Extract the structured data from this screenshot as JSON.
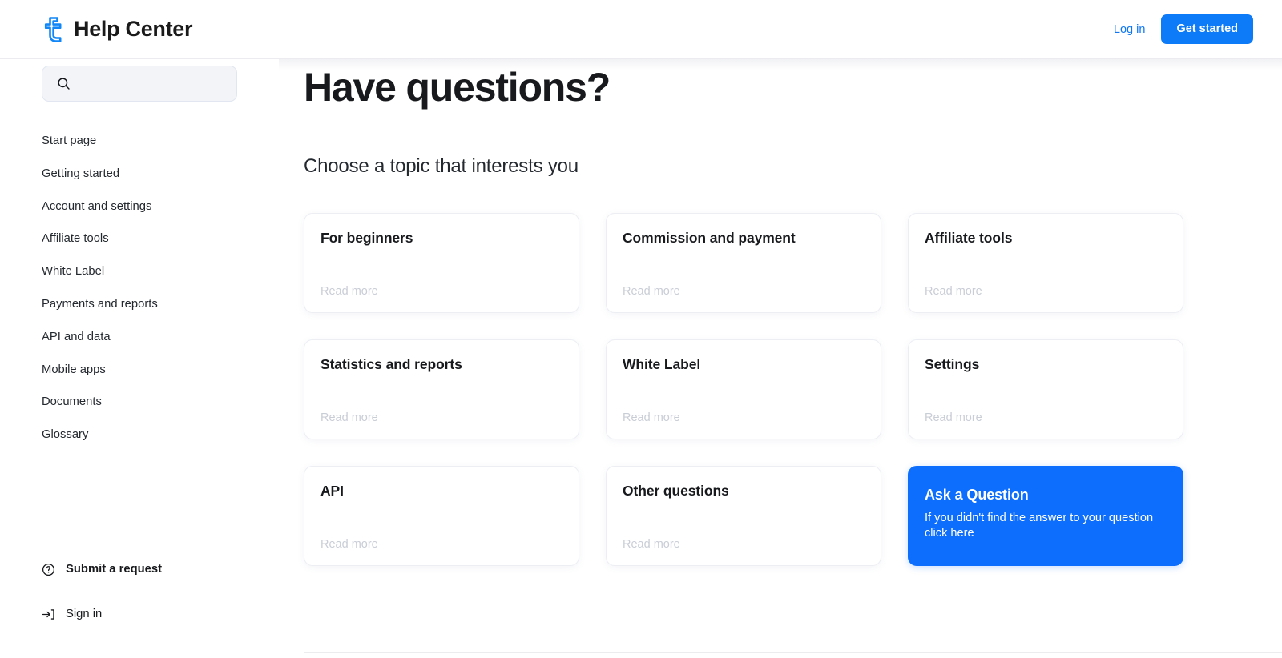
{
  "header": {
    "brand_title": "Help Center",
    "logo_icon": "help-center-t-logo",
    "login_label": "Log in",
    "get_started_label": "Get started",
    "accent_color": "#0d7bf7",
    "link_color": "#0d76f5"
  },
  "sidebar": {
    "search": {
      "icon": "search-icon",
      "value": "",
      "placeholder": ""
    },
    "items": [
      {
        "label": "Start page"
      },
      {
        "label": "Getting started"
      },
      {
        "label": "Account and settings"
      },
      {
        "label": "Affiliate tools"
      },
      {
        "label": "White Label"
      },
      {
        "label": "Payments and reports"
      },
      {
        "label": "API and data"
      },
      {
        "label": "Mobile apps"
      },
      {
        "label": "Documents"
      },
      {
        "label": "Glossary"
      }
    ],
    "bottom": {
      "submit_request": {
        "label": "Submit a request",
        "icon": "question-circle-icon"
      },
      "sign_in": {
        "label": "Sign in",
        "icon": "login-arrow-icon"
      }
    }
  },
  "main": {
    "title": "Have questions?",
    "subtitle": "Choose a topic that interests you",
    "read_more_label": "Read more",
    "cards": [
      {
        "title": "For beginners",
        "read_more": "Read more",
        "type": "topic"
      },
      {
        "title": "Commission and payment",
        "read_more": "Read more",
        "type": "topic"
      },
      {
        "title": "Affiliate tools",
        "read_more": "Read more",
        "type": "topic"
      },
      {
        "title": "Statistics and reports",
        "read_more": "Read more",
        "type": "topic"
      },
      {
        "title": "White Label",
        "read_more": "Read more",
        "type": "topic"
      },
      {
        "title": "Settings",
        "read_more": "Read more",
        "type": "topic"
      },
      {
        "title": "API",
        "read_more": "Read more",
        "type": "topic"
      },
      {
        "title": "Other questions",
        "read_more": "Read more",
        "type": "topic"
      }
    ],
    "promo_card": {
      "title": "Ask a Question",
      "subtitle": "If you didn't find the answer to your question click here",
      "background_color": "#0d6efd"
    }
  }
}
